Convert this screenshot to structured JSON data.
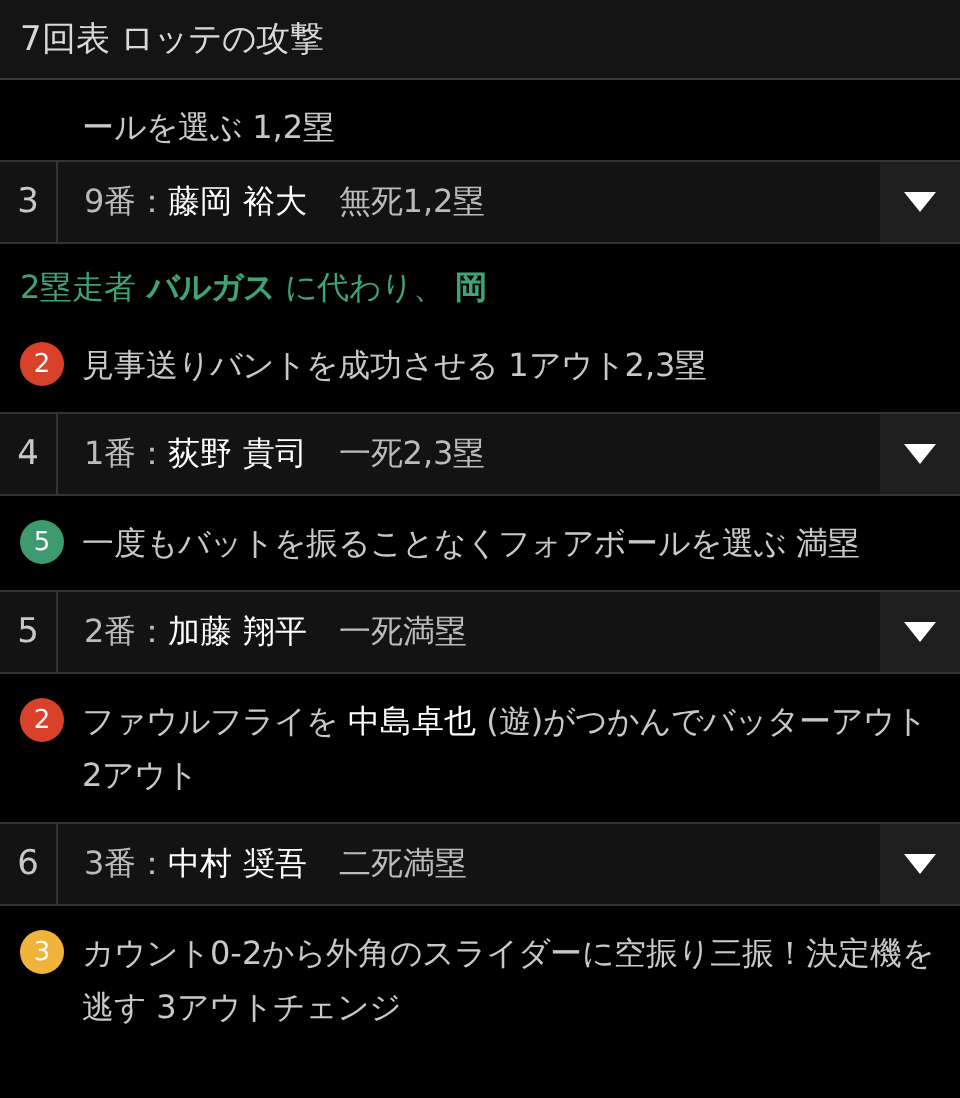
{
  "header": {
    "title": "7回表 ロッテの攻撃"
  },
  "items": [
    {
      "kind": "event",
      "text": "ールを選ぶ 1,2塁"
    },
    {
      "kind": "batter",
      "number": "3",
      "order": "9番：",
      "name": "藤岡 裕大",
      "situation": "無死1,2塁",
      "expanded": false
    },
    {
      "kind": "note",
      "text": "2塁走者 **バルガス** に代わり、 **岡**"
    },
    {
      "kind": "event",
      "badge": "2",
      "color": "#d9412b",
      "text": "見事送りバントを成功させる 1アウト2,3塁"
    },
    {
      "kind": "batter",
      "number": "4",
      "order": "1番：",
      "name": "荻野 貴司",
      "situation": "一死2,3塁",
      "expanded": false
    },
    {
      "kind": "event",
      "badge": "5",
      "color": "#3c9a6c",
      "text": "一度もバットを振ることなくフォアボールを選ぶ 満塁"
    },
    {
      "kind": "batter",
      "number": "5",
      "order": "2番：",
      "name": "加藤 翔平",
      "situation": "一死満塁",
      "expanded": false
    },
    {
      "kind": "event",
      "badge": "2",
      "color": "#d9412b",
      "text": "ファウルフライを **中島卓也** (遊)がつかんでバッターアウト 2アウト"
    },
    {
      "kind": "batter",
      "number": "6",
      "order": "3番：",
      "name": "中村 奨吾",
      "situation": "二死満塁",
      "expanded": false
    },
    {
      "kind": "event",
      "badge": "3",
      "color": "#f0b43a",
      "text": "カウント0-2から外角のスライダーに空振り三振！決定機を逃す 3アウトチェンジ"
    }
  ]
}
